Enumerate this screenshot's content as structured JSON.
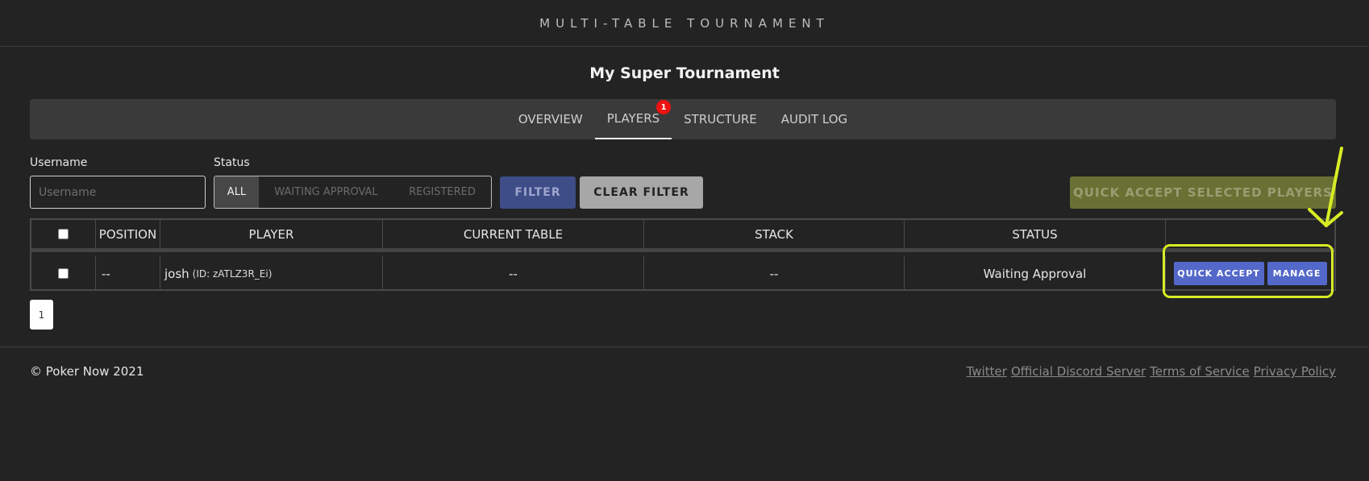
{
  "app": {
    "title": "MULTI-TABLE TOURNAMENT"
  },
  "tournament": {
    "name": "My Super Tournament"
  },
  "tabs": [
    {
      "label": "OVERVIEW"
    },
    {
      "label": "PLAYERS",
      "badge": "1",
      "active": true
    },
    {
      "label": "STRUCTURE"
    },
    {
      "label": "AUDIT LOG"
    }
  ],
  "filters": {
    "username_label": "Username",
    "username_placeholder": "Username",
    "username_value": "",
    "status_label": "Status",
    "status_options": [
      "ALL",
      "WAITING APPROVAL",
      "REGISTERED"
    ],
    "status_selected": "ALL",
    "filter_button": "FILTER",
    "clear_button": "CLEAR FILTER",
    "quick_accept_selected": "QUICK ACCEPT SELECTED PLAYERS"
  },
  "table": {
    "columns": [
      "POSITION",
      "PLAYER",
      "CURRENT TABLE",
      "STACK",
      "STATUS"
    ],
    "rows": [
      {
        "position": "--",
        "player": "josh",
        "player_id": "(ID: zATLZ3R_Ei)",
        "current_table": "--",
        "stack": "--",
        "status": "Waiting Approval",
        "quick_accept": "QUICK ACCEPT",
        "manage": "MANAGE"
      }
    ]
  },
  "pagination": {
    "current": "1"
  },
  "footer": {
    "copyright": "© Poker Now 2021",
    "links": [
      "Twitter",
      "Official Discord Server",
      "Terms of Service",
      "Privacy Policy"
    ]
  },
  "colors": {
    "background": "#232323",
    "accent_button": "#5468c9",
    "annotation_highlight": "#d8ec25",
    "badge": "#ee1111"
  }
}
